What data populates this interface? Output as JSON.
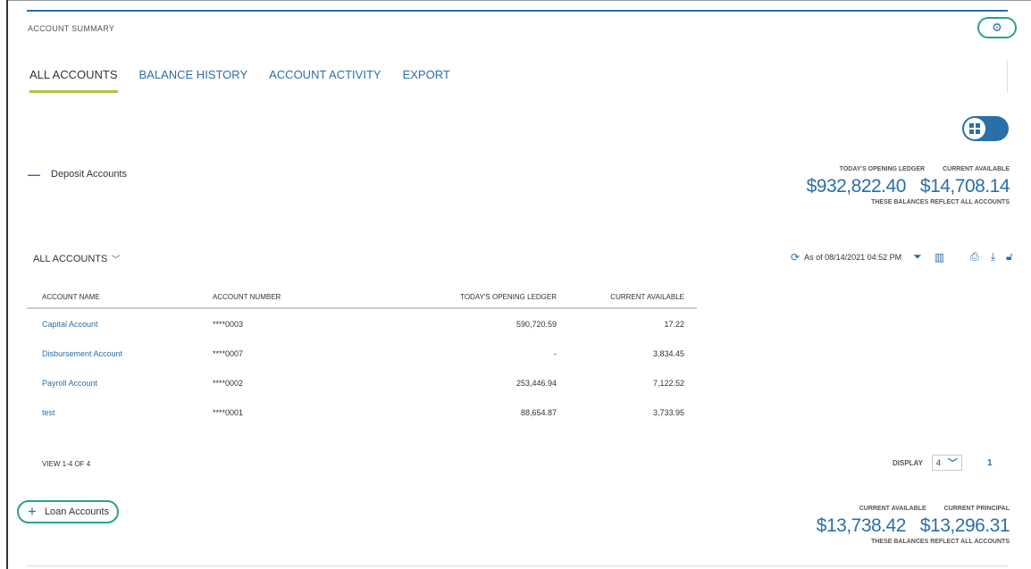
{
  "panel": {
    "title": "ACCOUNT SUMMARY",
    "settings_icon": "gear-icon"
  },
  "tabs": [
    {
      "label": "ALL ACCOUNTS",
      "active": true
    },
    {
      "label": "BALANCE HISTORY",
      "active": false
    },
    {
      "label": "ACCOUNT ACTIVITY",
      "active": false
    },
    {
      "label": "EXPORT",
      "active": false
    }
  ],
  "view_toggle": {
    "icon": "grid-view-icon"
  },
  "deposit": {
    "toggle_symbol": "—",
    "label": "Deposit Accounts",
    "balance_labels": [
      "TODAY'S OPENING LEDGER",
      "CURRENT AVAILABLE"
    ],
    "balance_values": [
      "$932,822.40",
      "$14,708.14"
    ],
    "note": "THESE BALANCES REFLECT ALL ACCOUNTS"
  },
  "filter": {
    "label": "ALL ACCOUNTS",
    "chevron": "﹀"
  },
  "toolbar": {
    "as_of": "As of 08/14/2021 04:52 PM",
    "icons": [
      "refresh-icon",
      "filter-icon",
      "columns-icon",
      "print-icon",
      "download-icon",
      "lock-icon"
    ]
  },
  "table": {
    "headers": [
      "ACCOUNT NAME",
      "ACCOUNT NUMBER",
      "TODAY'S OPENING LEDGER",
      "CURRENT AVAILABLE"
    ],
    "rows": [
      [
        "Capital Account",
        "****0003",
        "590,720.59",
        "17.22"
      ],
      [
        "Disbursement Account",
        "****0007",
        "-",
        "3,834.45"
      ],
      [
        "Payroll Account",
        "****0002",
        "253,446.94",
        "7,122.52"
      ],
      [
        "test",
        "****0001",
        "88,654.87",
        "3,733.95"
      ]
    ]
  },
  "pagination": {
    "view_count": "VIEW 1-4 OF 4",
    "display_label": "DISPLAY",
    "display_value": "4",
    "page": "1"
  },
  "loan": {
    "toggle_symbol": "+",
    "label": "Loan Accounts",
    "balance_labels": [
      "CURRENT AVAILABLE",
      "CURRENT PRINCIPAL"
    ],
    "balance_values": [
      "$13,738.42",
      "$13,296.31"
    ],
    "note": "THESE BALANCES REFLECT ALL ACCOUNTS"
  },
  "colors": {
    "accent": "#2a6fa8",
    "tab_underline": "#a9c640",
    "highlight_ring": "#27a38a"
  }
}
